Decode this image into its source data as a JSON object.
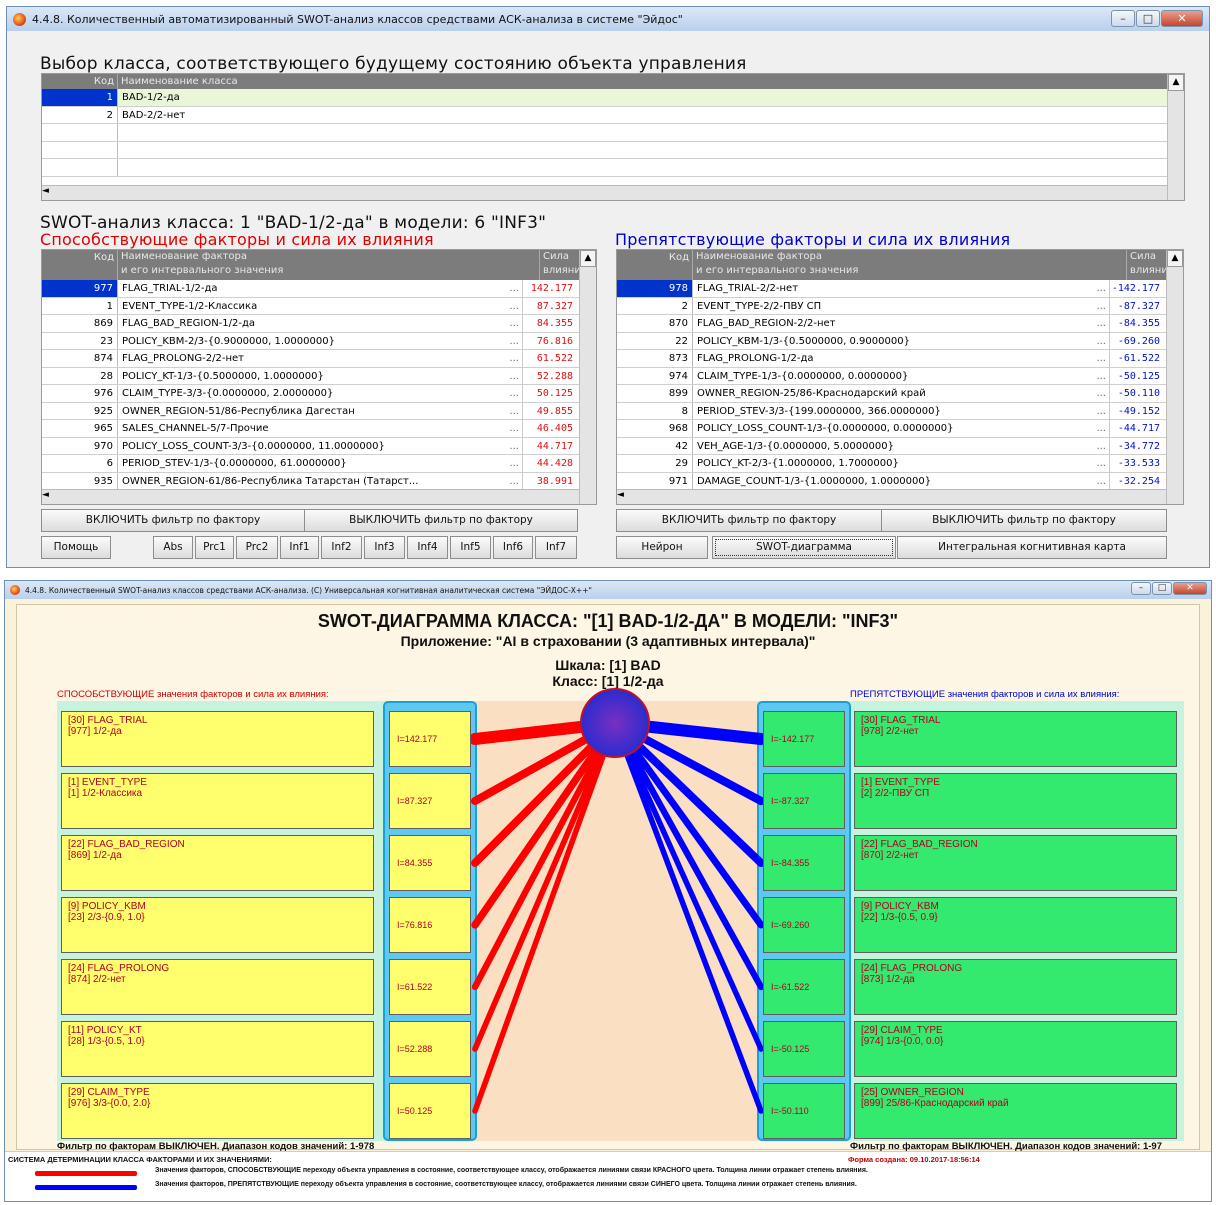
{
  "top_window": {
    "title": "4.4.8. Количественный автоматизированный SWOT-анализ классов средствами АСК-анализа в системе \"Эйдос\"",
    "heading": "Выбор класса, соответствующего будущему состоянию объекта управления",
    "class_grid": {
      "headers": [
        "Код",
        "Наименование класса"
      ],
      "rows": [
        {
          "code": "1",
          "name": "BAD-1/2-да"
        },
        {
          "code": "2",
          "name": "BAD-2/2-нет"
        }
      ]
    },
    "swot_heading": "SWOT-анализ класса: 1 \"BAD-1/2-да\" в модели: 6 \"INF3\"",
    "promoting_heading": "Способствующие факторы и сила их влияния",
    "hindering_heading": "Препятствующие факторы и сила их влияния",
    "grid_headers": {
      "code": "Код",
      "name1": "Наименование фактора",
      "name2": "и его интервального значения",
      "strength1": "Сила",
      "strength2": "влияния"
    },
    "promoting_rows": [
      {
        "code": "977",
        "name": "FLAG_TRIAL-1/2-да",
        "value": "142.177"
      },
      {
        "code": "1",
        "name": "EVENT_TYPE-1/2-Классика",
        "value": "87.327"
      },
      {
        "code": "869",
        "name": "FLAG_BAD_REGION-1/2-да",
        "value": "84.355"
      },
      {
        "code": "23",
        "name": "POLICY_KBM-2/3-{0.9000000, 1.0000000}",
        "value": "76.816"
      },
      {
        "code": "874",
        "name": "FLAG_PROLONG-2/2-нет",
        "value": "61.522"
      },
      {
        "code": "28",
        "name": "POLICY_KT-1/3-{0.5000000, 1.0000000}",
        "value": "52.288"
      },
      {
        "code": "976",
        "name": "CLAIM_TYPE-3/3-{0.0000000, 2.0000000}",
        "value": "50.125"
      },
      {
        "code": "925",
        "name": "OWNER_REGION-51/86-Республика Дагестан",
        "value": "49.855"
      },
      {
        "code": "965",
        "name": "SALES_CHANNEL-5/7-Прочие",
        "value": "46.405"
      },
      {
        "code": "970",
        "name": "POLICY_LOSS_COUNT-3/3-{0.0000000, 11.0000000}",
        "value": "44.717"
      },
      {
        "code": "6",
        "name": "PERIOD_STEV-1/3-{0.0000000, 61.0000000}",
        "value": "44.428"
      },
      {
        "code": "935",
        "name": "OWNER_REGION-61/86-Республика Татарстан (Татарст...",
        "value": "38.991"
      }
    ],
    "hindering_rows": [
      {
        "code": "978",
        "name": "FLAG_TRIAL-2/2-нет",
        "value": "-142.177"
      },
      {
        "code": "2",
        "name": "EVENT_TYPE-2/2-ПВУ СП",
        "value": "-87.327"
      },
      {
        "code": "870",
        "name": "FLAG_BAD_REGION-2/2-нет",
        "value": "-84.355"
      },
      {
        "code": "22",
        "name": "POLICY_KBM-1/3-{0.5000000, 0.9000000}",
        "value": "-69.260"
      },
      {
        "code": "873",
        "name": "FLAG_PROLONG-1/2-да",
        "value": "-61.522"
      },
      {
        "code": "974",
        "name": "CLAIM_TYPE-1/3-{0.0000000, 0.0000000}",
        "value": "-50.125"
      },
      {
        "code": "899",
        "name": "OWNER_REGION-25/86-Краснодарский край",
        "value": "-50.110"
      },
      {
        "code": "8",
        "name": "PERIOD_STEV-3/3-{199.0000000, 366.0000000}",
        "value": "-49.152"
      },
      {
        "code": "968",
        "name": "POLICY_LOSS_COUNT-1/3-{0.0000000, 0.0000000}",
        "value": "-44.717"
      },
      {
        "code": "42",
        "name": "VEH_AGE-1/3-{0.0000000, 5.0000000}",
        "value": "-34.772"
      },
      {
        "code": "29",
        "name": "POLICY_KT-2/3-{1.0000000, 1.7000000}",
        "value": "-33.533"
      },
      {
        "code": "971",
        "name": "DAMAGE_COUNT-1/3-{1.0000000, 1.0000000}",
        "value": "-32.254"
      }
    ],
    "buttons": {
      "filter_on": "ВКЛЮЧИТЬ фильтр по фактору",
      "filter_off": "ВЫКЛЮЧИТЬ фильтр по фактору",
      "help": "Помощь",
      "models": [
        "Abs",
        "Prc1",
        "Prc2",
        "Inf1",
        "Inf2",
        "Inf3",
        "Inf4",
        "Inf5",
        "Inf6",
        "Inf7"
      ],
      "neuron": "Нейрон",
      "swot_diagram": "SWOT-диаграмма",
      "cognitive_map": "Интегральная когнитивная карта"
    }
  },
  "bottom_window": {
    "title": "4.4.8. Количественный SWOT-анализ классов средствами АСК-анализа.  (С) Универсальная когнитивная аналитическая система \"ЭЙДОС-Х++\"",
    "diagram_title": "SWOT-ДИАГРАММА КЛАССА: \"[1] BAD-1/2-ДА\" В МОДЕЛИ: \"INF3\"",
    "application": "Приложение: \"AI в страховании (3 адаптивных интервала)\"",
    "scale": "Шкала: [1] BAD",
    "class_label": "Класс: [1] 1/2-да",
    "promoting_label": "СПОСОБСТВУЮЩИЕ значения факторов и сила их влияния:",
    "hindering_label": "ПРЕПЯТСТВУЮЩИЕ значения факторов и сила их влияния:",
    "promoting": [
      {
        "f": "[30] FLAG_TRIAL",
        "v": "[977] 1/2-да",
        "i": "I=142.177",
        "w": 142.177
      },
      {
        "f": "[1] EVENT_TYPE",
        "v": "[1] 1/2-Классика",
        "i": "I=87.327",
        "w": 87.327
      },
      {
        "f": "[22] FLAG_BAD_REGION",
        "v": "[869] 1/2-да",
        "i": "I=84.355",
        "w": 84.355
      },
      {
        "f": "[9] POLICY_KBM",
        "v": "[23] 2/3-{0.9, 1.0}",
        "i": "I=76.816",
        "w": 76.816
      },
      {
        "f": "[24] FLAG_PROLONG",
        "v": "[874] 2/2-нет",
        "i": "I=61.522",
        "w": 61.522
      },
      {
        "f": "[11] POLICY_KT",
        "v": "[28] 1/3-{0.5, 1.0}",
        "i": "I=52.288",
        "w": 52.288
      },
      {
        "f": "[29] CLAIM_TYPE",
        "v": "[976] 3/3-{0.0, 2.0}",
        "i": "I=50.125",
        "w": 50.125
      }
    ],
    "hindering": [
      {
        "f": "[30] FLAG_TRIAL",
        "v": "[978] 2/2-нет",
        "i": "I=-142.177",
        "w": 142.177
      },
      {
        "f": "[1] EVENT_TYPE",
        "v": "[2] 2/2-ПВУ СП",
        "i": "I=-87.327",
        "w": 87.327
      },
      {
        "f": "[22] FLAG_BAD_REGION",
        "v": "[870] 2/2-нет",
        "i": "I=-84.355",
        "w": 84.355
      },
      {
        "f": "[9] POLICY_KBM",
        "v": "[22] 1/3-{0.5, 0.9}",
        "i": "I=-69.260",
        "w": 69.26
      },
      {
        "f": "[24] FLAG_PROLONG",
        "v": "[873] 1/2-да",
        "i": "I=-61.522",
        "w": 61.522
      },
      {
        "f": "[29] CLAIM_TYPE",
        "v": "[974] 1/3-{0.0, 0.0}",
        "i": "I=-50.125",
        "w": 50.125
      },
      {
        "f": "[25] OWNER_REGION",
        "v": "[899] 25/86-Краснодарский край",
        "i": "I=-50.110",
        "w": 50.11
      }
    ],
    "filter_left": "Фильтр по факторам ВЫКЛЮЧЕН. Диапазон кодов значений: 1-978",
    "filter_right": "Фильтр по факторам ВЫКЛЮЧЕН. Диапазон кодов значений: 1-97",
    "legend_title": "СИСТЕМА ДЕТЕРМИНАЦИИ КЛАССА ФАКТОРАМИ И ИХ ЗНАЧЕНИЯМИ:",
    "created": "Форма создана: 09.10.2017-18:56:14",
    "legend_red": "Значения факторов, СПОСОБСТВУЮЩИЕ переходу объекта управления в состояние, соответствующее классу, отображается линиями связи КРАСНОГО цвета. Толщина линии отражает степень влияния.",
    "legend_blue": "Значения факторов, ПРЕПЯТСТВУЮЩИЕ переходу объекта управления в состояние, соответствующее классу, отображается линиями связи СИНЕГО цвета. Толщина линии отражает степень влияния."
  },
  "colors": {
    "red": "#ff0000",
    "blue": "#0000ff",
    "yellow": "#ffff6e",
    "green": "#33e96e",
    "cyan": "#5ec8f0",
    "peach": "#fbdfc2",
    "mint": "#c7f2dd"
  }
}
